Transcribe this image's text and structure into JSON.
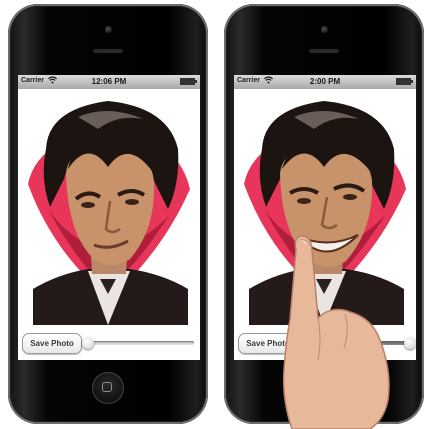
{
  "phones": [
    {
      "status": {
        "carrier": "Carrier",
        "time": "12:06 PM"
      },
      "save_button": "Save Photo",
      "slider_value": 0.0
    },
    {
      "status": {
        "carrier": "Carrier",
        "time": "2:00 PM"
      },
      "save_button": "Save Photo",
      "slider_value": 1.0
    }
  ],
  "colors": {
    "cape_red": "#e8365a",
    "hair": "#1c1410",
    "skin": "#c8926a"
  },
  "icons": [
    "wifi-icon",
    "battery-icon",
    "home-button-icon"
  ]
}
